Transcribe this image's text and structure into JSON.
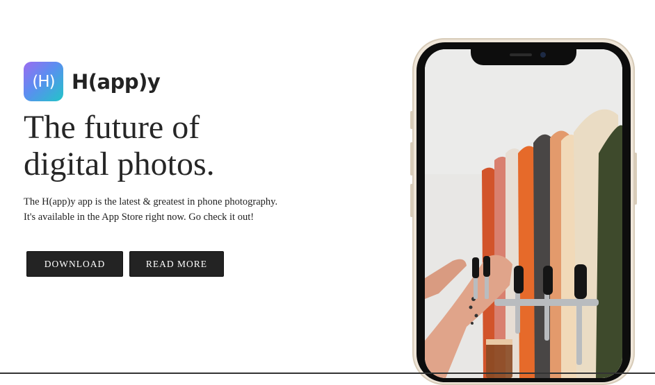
{
  "app": {
    "icon_glyph": "(H)",
    "brand_name": "H(app)y",
    "icon_gradient": [
      "#9b6cf0",
      "#5b8ef0",
      "#22c4c8"
    ]
  },
  "hero": {
    "headline_line1": "The future of",
    "headline_line2": "digital photos.",
    "desc_line1": "The H(app)y app is the latest & greatest in phone photography.",
    "desc_line2": "It's available in the App Store right now. Go check it out!"
  },
  "buttons": {
    "download_label": "DOWNLOAD",
    "read_more_label": "READ MORE"
  },
  "phone": {
    "frame_color": "#efe6d9",
    "screen_content": "photo of skateboard-handle beer taps with a hand pouring a glass"
  }
}
